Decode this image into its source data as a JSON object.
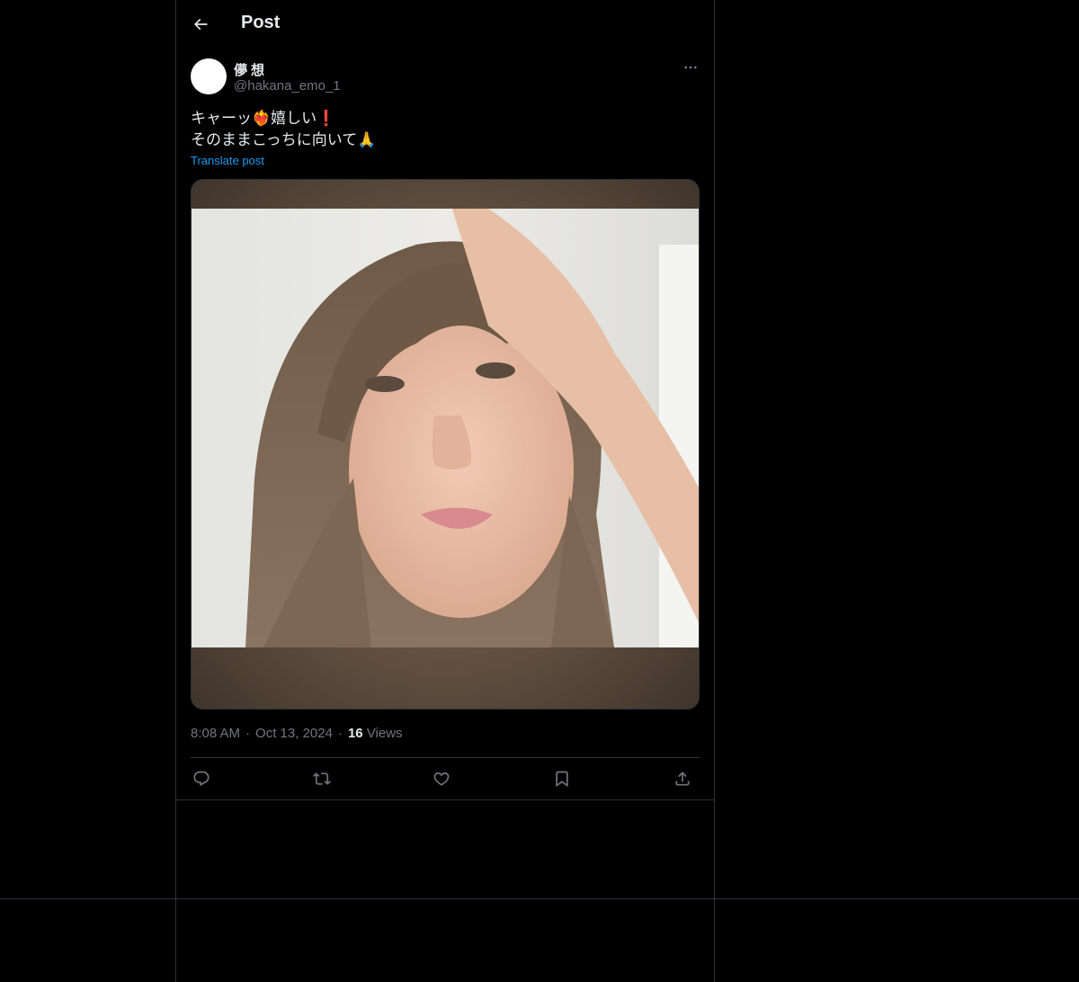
{
  "header": {
    "title": "Post",
    "back_icon": "arrow-left-icon"
  },
  "author": {
    "display_name": "儚想",
    "handle": "@hakana_emo_1",
    "more_icon": "more-horizontal-icon"
  },
  "post": {
    "line1": "キャーッ❤️‍🔥嬉しい❗",
    "line2": "そのままこっちに向いて🙏",
    "translate_label": "Translate post"
  },
  "meta": {
    "time": "8:08 AM",
    "date": "Oct 13, 2024",
    "separator": "·",
    "views_count": "16",
    "views_label": "Views"
  },
  "actions": [
    {
      "name": "reply",
      "icon": "reply-icon"
    },
    {
      "name": "repost",
      "icon": "repost-icon"
    },
    {
      "name": "like",
      "icon": "heart-icon"
    },
    {
      "name": "bookmark",
      "icon": "bookmark-icon"
    },
    {
      "name": "share",
      "icon": "share-icon"
    }
  ],
  "colors": {
    "background": "#000000",
    "text": "#e7e9ea",
    "secondary": "#71767b",
    "link": "#1d9bf0",
    "border": "#2f3336"
  }
}
